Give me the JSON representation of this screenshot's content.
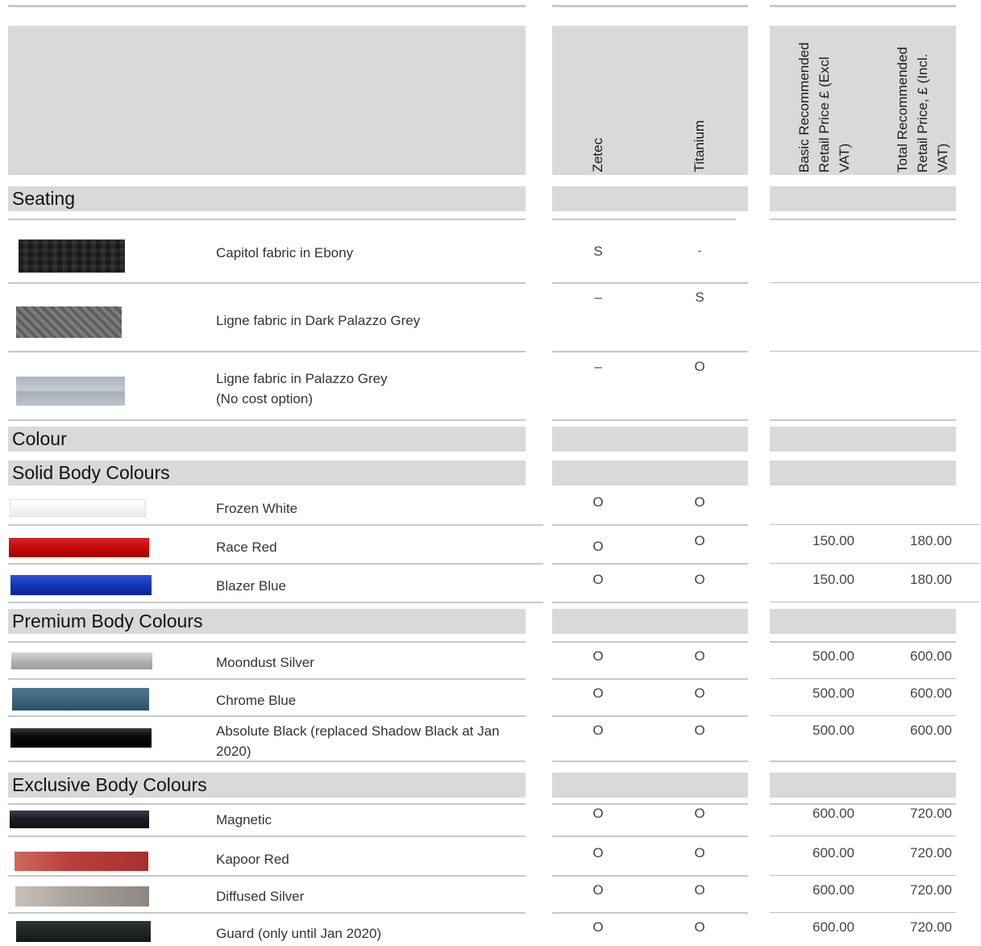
{
  "header": {
    "zetec": "Zetec",
    "titanium": "Titanium",
    "basic_price": "Basic Recommended Retail Price £ (Excl VAT)",
    "total_price": "Total Recommended Retail Price, £ (Incl. VAT)"
  },
  "sections": {
    "seating": "Seating",
    "colour": "Colour",
    "solid": "Solid Body Colours",
    "premium": "Premium Body Colours",
    "exclusive": "Exclusive Body Colours"
  },
  "seating": [
    {
      "desc": "Capitol fabric in Ebony",
      "zetec": "S",
      "titanium": "-"
    },
    {
      "desc": "Ligne fabric in Dark Palazzo Grey",
      "zetec": "–",
      "titanium": "S"
    },
    {
      "desc": "Ligne fabric in Palazzo Grey",
      "desc2": "(No cost option)",
      "zetec": "–",
      "titanium": "O"
    }
  ],
  "solid": [
    {
      "desc": "Frozen White",
      "zetec": "O",
      "titanium": "O",
      "basic": "",
      "total": ""
    },
    {
      "desc": "Race Red",
      "zetec": "O",
      "titanium": "O",
      "basic": "150.00",
      "total": "180.00"
    },
    {
      "desc": "Blazer Blue",
      "zetec": "O",
      "titanium": "O",
      "basic": "150.00",
      "total": "180.00"
    }
  ],
  "premium": [
    {
      "desc": "Moondust Silver",
      "zetec": "O",
      "titanium": "O",
      "basic": "500.00",
      "total": "600.00"
    },
    {
      "desc": "Chrome Blue",
      "zetec": "O",
      "titanium": "O",
      "basic": "500.00",
      "total": "600.00"
    },
    {
      "desc": "Absolute Black (replaced Shadow Black at Jan 2020)",
      "zetec": "O",
      "titanium": "O",
      "basic": "500.00",
      "total": "600.00"
    }
  ],
  "exclusive": [
    {
      "desc": "Magnetic",
      "zetec": "O",
      "titanium": "O",
      "basic": "600.00",
      "total": "720.00"
    },
    {
      "desc": "Kapoor Red",
      "zetec": "O",
      "titanium": "O",
      "basic": "600.00",
      "total": "720.00"
    },
    {
      "desc": "Diffused Silver",
      "zetec": "O",
      "titanium": "O",
      "basic": "600.00",
      "total": "720.00"
    },
    {
      "desc": "Guard (only until Jan 2020)",
      "zetec": "O",
      "titanium": "O",
      "basic": "600.00",
      "total": "720.00"
    }
  ],
  "swatch_colors": {
    "capitol_ebony": "#6a6a6a",
    "ligne_dark_palazzo": "#6e6e6e",
    "ligne_palazzo": "#b4bac2",
    "frozen_white": "#f4f4f4",
    "race_red": "#c40a0a",
    "blazer_blue": "#1234b8",
    "moondust_silver": "#b3b3b3",
    "chrome_blue": "#3f6580",
    "absolute_black": "#0a0a0a",
    "magnetic": "#1b1e24",
    "kapoor_red": "#b9403c",
    "diffused_silver": "#a8a19b",
    "guard": "#1e2620"
  }
}
